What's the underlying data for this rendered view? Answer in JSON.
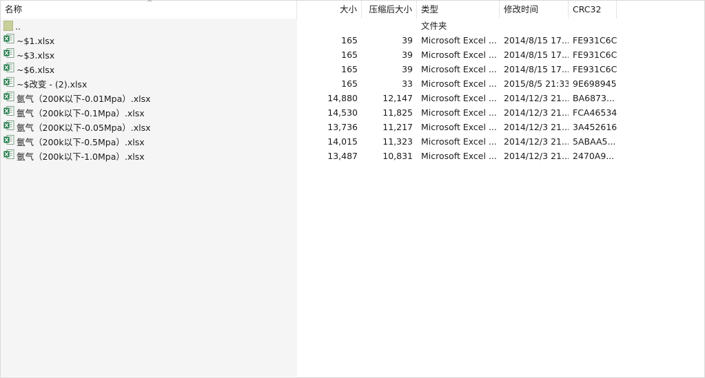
{
  "columns": {
    "name": "名称",
    "size": "大小",
    "packed": "压缩后大小",
    "type": "类型",
    "modified": "修改时间",
    "crc": "CRC32"
  },
  "parent_row": {
    "name": "..",
    "type": "文件夹"
  },
  "files": [
    {
      "name": "~$1.xlsx",
      "size": "165",
      "packed": "39",
      "type": "Microsoft Excel ...",
      "modified": "2014/8/15 17...",
      "crc": "FE931C6C"
    },
    {
      "name": "~$3.xlsx",
      "size": "165",
      "packed": "39",
      "type": "Microsoft Excel ...",
      "modified": "2014/8/15 17...",
      "crc": "FE931C6C"
    },
    {
      "name": "~$6.xlsx",
      "size": "165",
      "packed": "39",
      "type": "Microsoft Excel ...",
      "modified": "2014/8/15 17...",
      "crc": "FE931C6C"
    },
    {
      "name": "~$改变 - (2).xlsx",
      "size": "165",
      "packed": "33",
      "type": "Microsoft Excel ...",
      "modified": "2015/8/5 21:33",
      "crc": "9E698945"
    },
    {
      "name": "氩气（200K以下-0.01Mpa）.xlsx",
      "size": "14,880",
      "packed": "12,147",
      "type": "Microsoft Excel ...",
      "modified": "2014/12/3 21...",
      "crc": "BA6873..."
    },
    {
      "name": "氩气（200k以下-0.1Mpa）.xlsx",
      "size": "14,530",
      "packed": "11,825",
      "type": "Microsoft Excel ...",
      "modified": "2014/12/3 21...",
      "crc": "FCA46534"
    },
    {
      "name": "氩气（200K以下-0.05Mpa）.xlsx",
      "size": "13,736",
      "packed": "11,217",
      "type": "Microsoft Excel ...",
      "modified": "2014/12/3 21...",
      "crc": "3A452616"
    },
    {
      "name": "氩气（200k以下-0.5Mpa）.xlsx",
      "size": "14,015",
      "packed": "11,323",
      "type": "Microsoft Excel ...",
      "modified": "2014/12/3 21...",
      "crc": "5ABAA5..."
    },
    {
      "name": "氩气（200k以下-1.0Mpa）.xlsx",
      "size": "13,487",
      "packed": "10,831",
      "type": "Microsoft Excel ...",
      "modified": "2014/12/3 21...",
      "crc": "2470A9..."
    }
  ],
  "icons": {
    "folder": "folder-up-icon",
    "file": "excel-file-icon"
  },
  "colors": {
    "name_column_bg": "#f5f5f5",
    "excel_green": "#1d7a45"
  }
}
